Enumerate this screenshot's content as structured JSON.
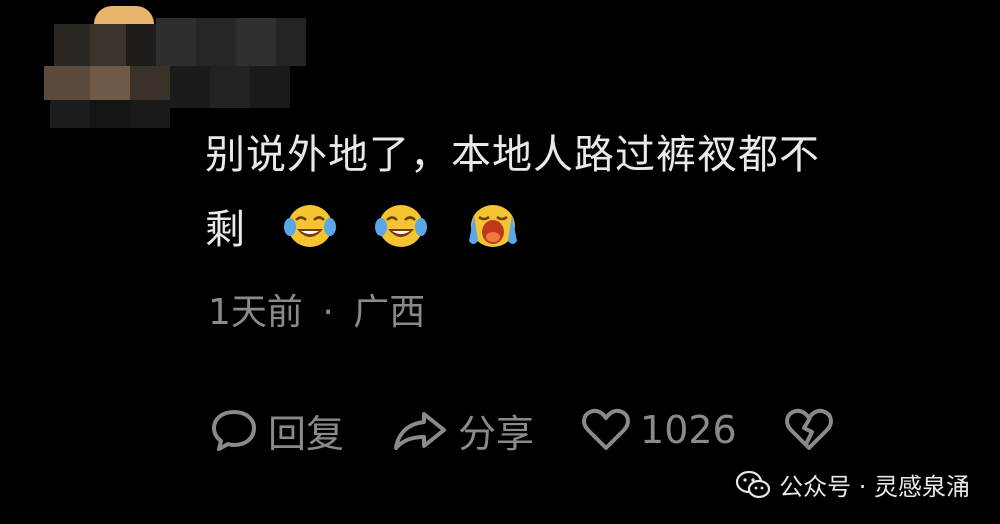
{
  "comment": {
    "text_line1": "别说外地了，本地人路过裤衩都不",
    "text_line2": "剩",
    "emojis": [
      "laugh-cry-emoji",
      "laugh-cry-emoji",
      "crying-emoji"
    ]
  },
  "meta": {
    "time": "1天前",
    "separator": "·",
    "location": "广西"
  },
  "actions": {
    "reply_label": "回复",
    "share_label": "分享",
    "like_count": "1026"
  },
  "watermark": {
    "text": "公众号 · 灵感泉涌",
    "icon": "wechat-icon"
  },
  "colors": {
    "background": "#000000",
    "text": "#e9e9e9",
    "muted": "#8a8a8a",
    "emoji_yellow": "#f5c431",
    "emoji_tear": "#5aa6e6"
  }
}
